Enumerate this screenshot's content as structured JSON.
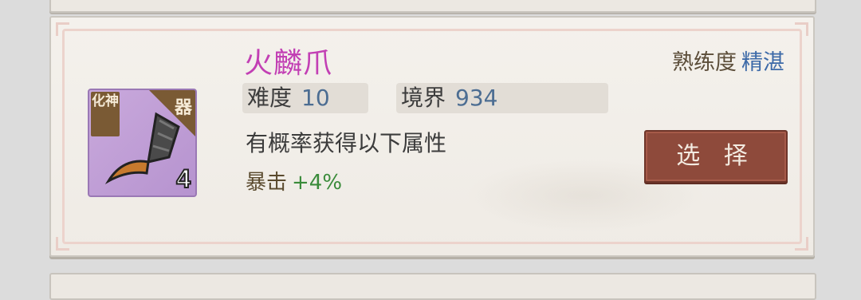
{
  "item": {
    "name": "火麟爪",
    "rank_badge": "化神",
    "type_badge": "器",
    "count": "4",
    "icon": "claw-icon"
  },
  "proficiency": {
    "label": "熟练度",
    "value": "精湛"
  },
  "stats": {
    "difficulty_label": "难度",
    "difficulty_value": "10",
    "realm_label": "境界",
    "realm_value": "934"
  },
  "description": "有概率获得以下属性",
  "attribute": {
    "name": "暴击",
    "bonus": "+4%"
  },
  "select_button": "选 择",
  "colors": {
    "title": "#c23fb4",
    "proficiency_value": "#3d6aa8",
    "bonus": "#3a8b3a",
    "button": "#8e4a3b"
  }
}
